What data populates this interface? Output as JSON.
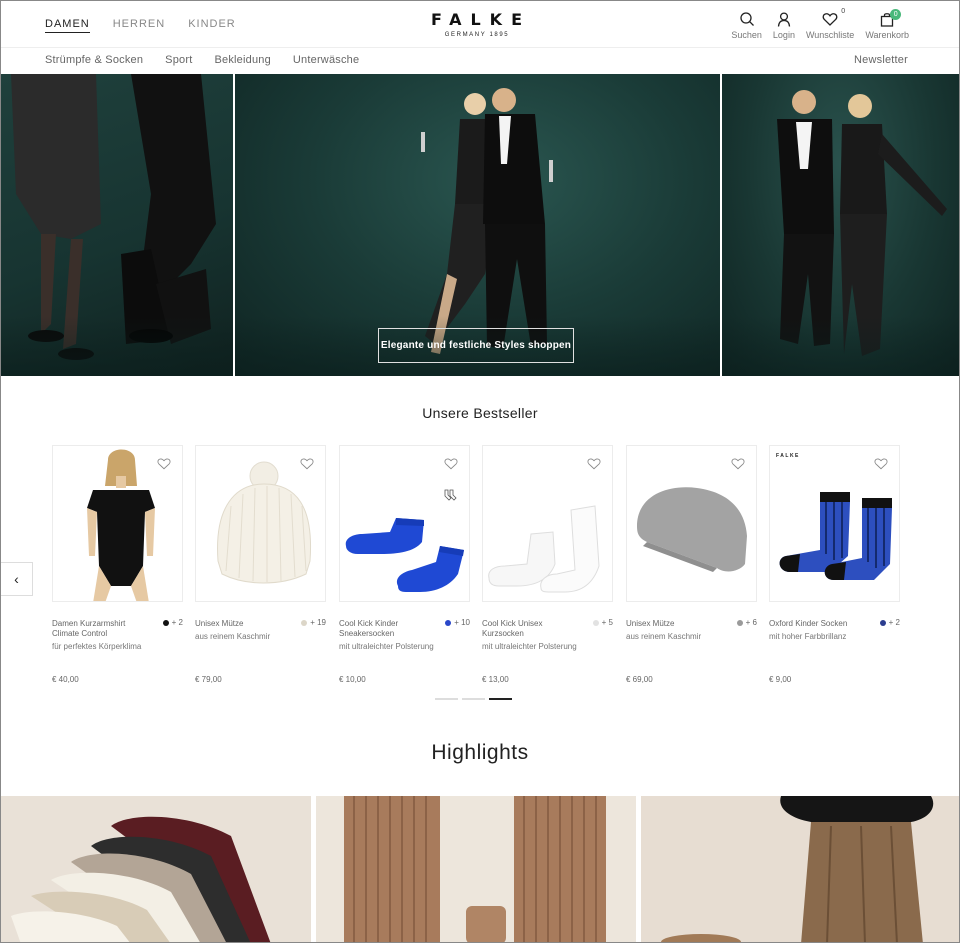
{
  "header": {
    "gender_tabs": [
      {
        "label": "DAMEN",
        "active": true
      },
      {
        "label": "HERREN",
        "active": false
      },
      {
        "label": "KINDER",
        "active": false
      }
    ],
    "logo": {
      "word": "FALKE",
      "sub": "GERMANY 1895"
    },
    "actions": {
      "search": "Suchen",
      "login": "Login",
      "wishlist": "Wunschliste",
      "wishlist_count": "0",
      "cart": "Warenkorb",
      "cart_count": "0"
    }
  },
  "category_nav": {
    "items": [
      "Strümpfe & Socken",
      "Sport",
      "Bekleidung",
      "Unterwäsche"
    ],
    "newsletter": "Newsletter"
  },
  "hero": {
    "button_label": "Elegante und festliche Styles shoppen"
  },
  "bestseller": {
    "title": "Unsere Bestseller",
    "products": [
      {
        "name": "Damen Kurzarmshirt Climate Control",
        "sub": "für perfektes Körperklima",
        "price": "€ 40,00",
        "swatch_color": "#111111",
        "more": "+ 2"
      },
      {
        "name": "Unisex Mütze",
        "sub": "aus reinem Kaschmir",
        "price": "€ 79,00",
        "swatch_color": "#dcd6c8",
        "more": "+ 19"
      },
      {
        "name": "Cool Kick Kinder Sneakersocken",
        "sub": "mit ultraleichter Polsterung",
        "price": "€ 10,00",
        "swatch_color": "#2a47c9",
        "more": "+ 10"
      },
      {
        "name": "Cool Kick Unisex Kurzsocken",
        "sub": "mit ultraleichter Polsterung",
        "price": "€ 13,00",
        "swatch_color": "#e2e2e2",
        "more": "+ 5"
      },
      {
        "name": "Unisex Mütze",
        "sub": "aus reinem Kaschmir",
        "price": "€ 69,00",
        "swatch_color": "#9a9a9a",
        "more": "+ 6"
      },
      {
        "name": "Oxford Kinder Socken",
        "sub": "mit hoher Farbbrillanz",
        "price": "€ 9,00",
        "swatch_color": "#2b3d8f",
        "more": "+ 2"
      }
    ],
    "product_badge_text": "FALKE"
  },
  "highlights": {
    "title": "Highlights"
  },
  "colors": {
    "cart_badge": "#49b87a",
    "hero_bg": "#1a3b37"
  }
}
